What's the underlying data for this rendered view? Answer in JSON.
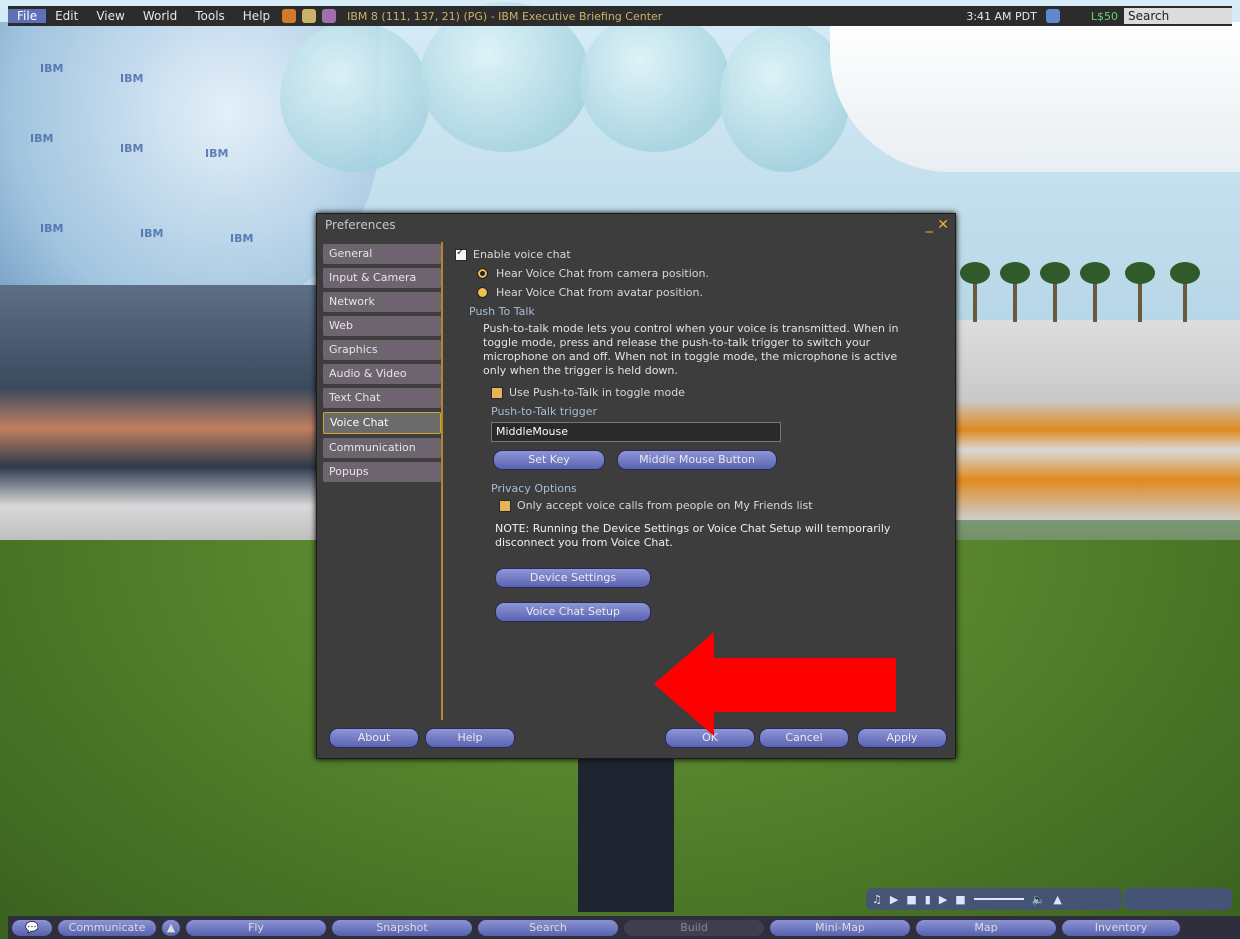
{
  "menubar": {
    "items": [
      "File",
      "Edit",
      "View",
      "World",
      "Tools",
      "Help"
    ],
    "location": "IBM 8 (111, 137, 21) (PG) - IBM Executive Briefing Center",
    "time": "3:41 AM PDT",
    "balance": "L$50",
    "search_label": "Search"
  },
  "prefs": {
    "title": "Preferences",
    "tabs": [
      "General",
      "Input & Camera",
      "Network",
      "Web",
      "Graphics",
      "Audio & Video",
      "Text Chat",
      "Voice Chat",
      "Communication",
      "Popups"
    ],
    "active_tab": "Voice Chat",
    "enable_voice_label": "Enable voice chat",
    "radio_camera": "Hear Voice Chat from camera position.",
    "radio_avatar": "Hear Voice Chat from avatar position.",
    "ptt_heading": "Push To Talk",
    "ptt_text": "Push-to-talk mode lets you control when your voice is transmitted. When in toggle mode, press and release the push-to-talk trigger to switch your microphone on and off. When not in toggle mode, the microphone is active only when the trigger is held down.",
    "toggle_label": "Use Push-to-Talk in toggle mode",
    "trigger_heading": "Push-to-Talk trigger",
    "trigger_value": "MiddleMouse",
    "set_key_label": "Set Key",
    "middle_mouse_label": "Middle Mouse Button",
    "privacy_heading": "Privacy Options",
    "privacy_label": "Only accept voice calls from people on My Friends list",
    "note_text": "NOTE: Running the Device Settings or Voice Chat Setup will temporarily disconnect you from Voice Chat.",
    "device_settings_label": "Device Settings",
    "voice_setup_label": "Voice Chat Setup",
    "about_label": "About",
    "help_label": "Help",
    "ok_label": "OK",
    "cancel_label": "Cancel",
    "apply_label": "Apply"
  },
  "bottombar": [
    "Communicate",
    "Fly",
    "Snapshot",
    "Search",
    "Build",
    "Mini-Map",
    "Map",
    "Inventory"
  ],
  "colors": {
    "arrow": "#ff0000",
    "accent": "#d4a32a",
    "button": "#6b74c2"
  }
}
